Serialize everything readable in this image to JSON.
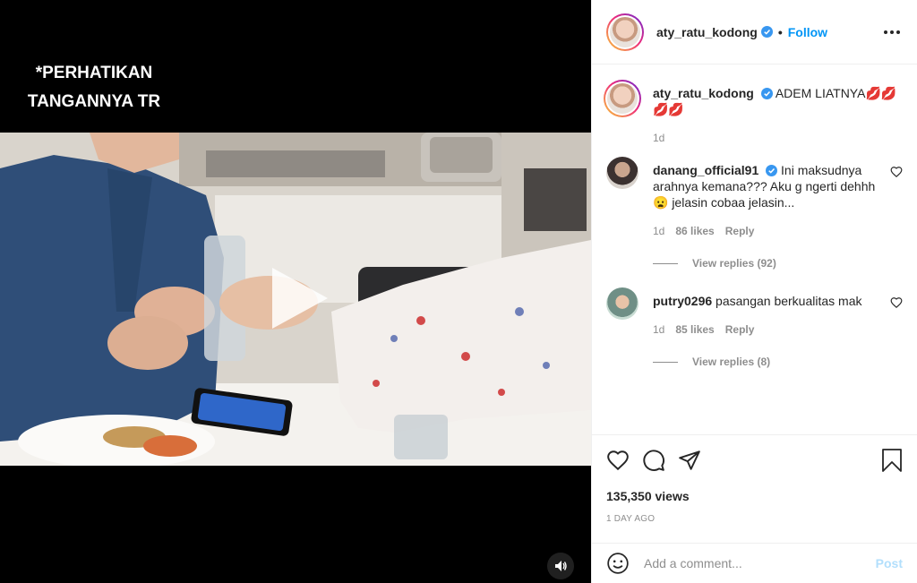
{
  "video": {
    "overlay_caption_line1": "*PERHATIKAN",
    "overlay_caption_line2": "TANGANNYA TR"
  },
  "post": {
    "author": "aty_ratu_kodong",
    "follow_label": "Follow",
    "dot": "•",
    "caption_text": "ADEM LIATNYA💋💋💋💋",
    "caption_time": "1d",
    "views": "135,350 views",
    "posted_ago": "1 DAY AGO"
  },
  "comments": [
    {
      "username": "danang_official91",
      "verified": true,
      "text": "Ini maksudnya arahnya kemana??? Aku g ngerti dehhh😦 jelasin cobaa jelasin...",
      "time": "1d",
      "likes": "86 likes",
      "reply_label": "Reply",
      "view_replies": "View replies (92)"
    },
    {
      "username": "putry0296",
      "verified": false,
      "text": "pasangan berkualitas mak",
      "time": "1d",
      "likes": "85 likes",
      "reply_label": "Reply",
      "view_replies": "View replies (8)"
    }
  ],
  "composer": {
    "placeholder": "Add a comment...",
    "post_label": "Post"
  },
  "colors": {
    "accent": "#0095f6",
    "post_disabled": "#b2dffc",
    "muted": "#8e8e8e",
    "video_bg": "#000000"
  },
  "icons": [
    "verified-badge-icon",
    "more-options-icon",
    "heart-icon",
    "comment-icon",
    "share-icon",
    "bookmark-icon",
    "emoji-icon",
    "play-icon",
    "speaker-icon"
  ]
}
